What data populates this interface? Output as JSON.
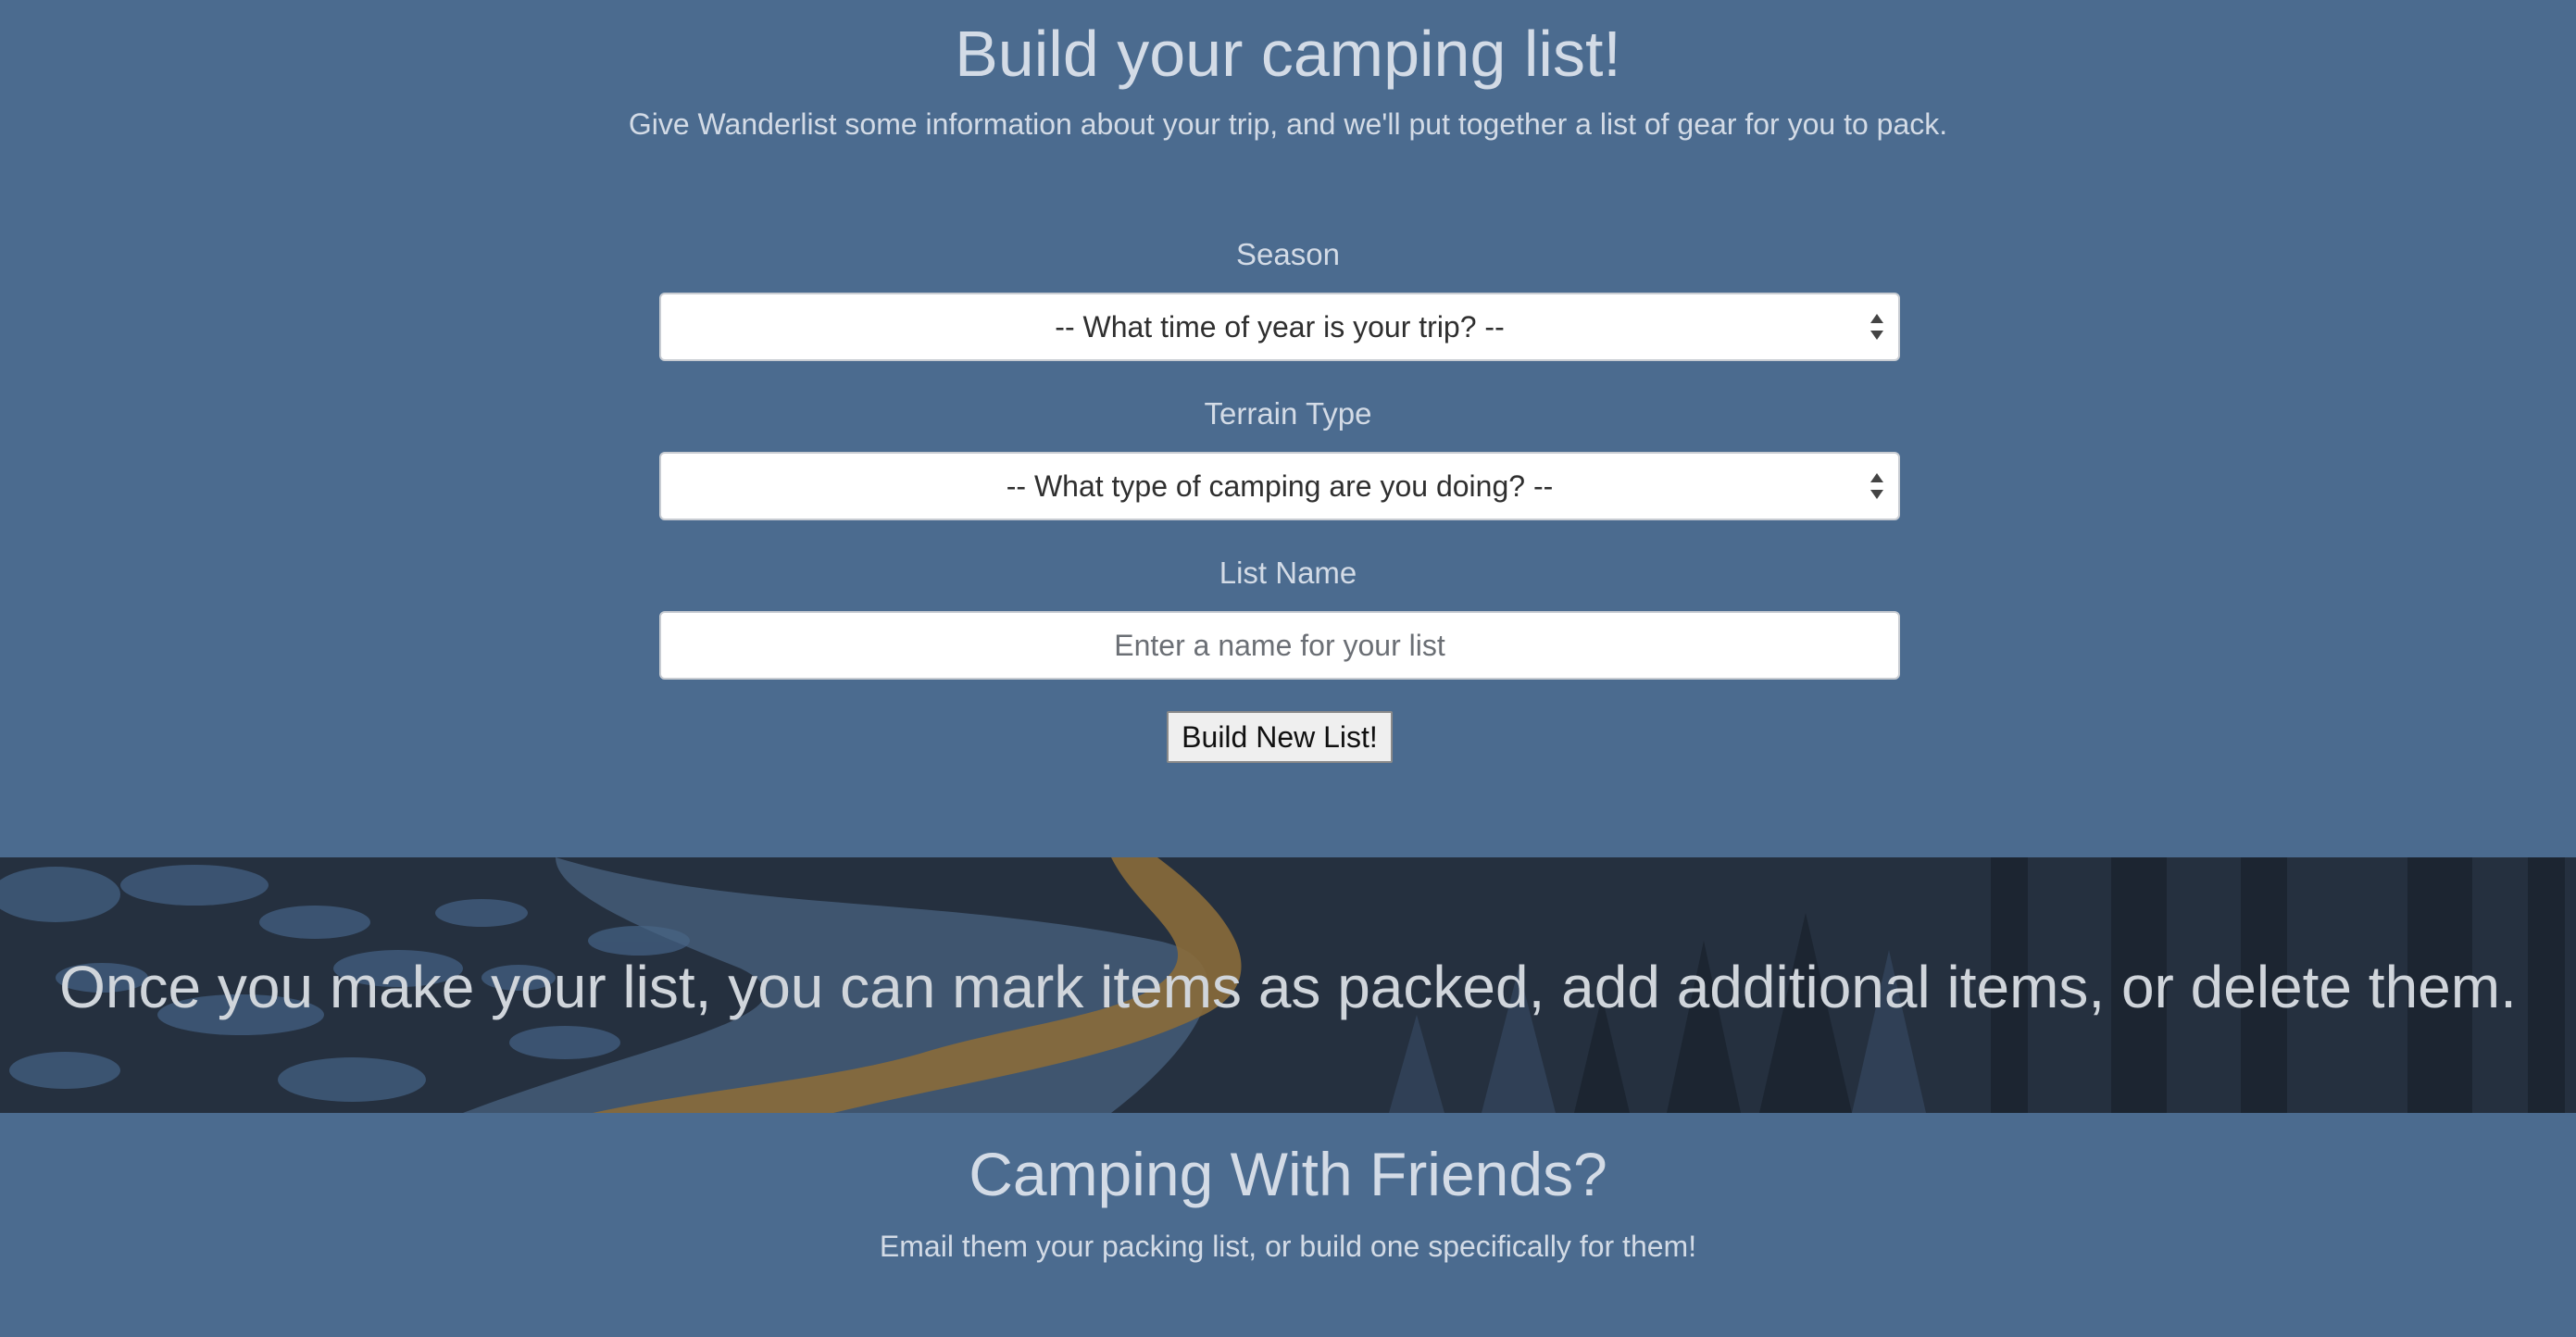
{
  "build": {
    "title": "Build your camping list!",
    "subtitle": "Give Wanderlist some information about your trip, and we'll put together a list of gear for you to pack.",
    "season_label": "Season",
    "season_value": "-- What time of year is your trip? --",
    "terrain_label": "Terrain Type",
    "terrain_value": "-- What type of camping are you doing? --",
    "list_name_label": "List Name",
    "list_name_placeholder": "Enter a name for your list",
    "button_label": "Build New List!"
  },
  "banner": {
    "text": "Once you make your list, you can mark items as packed, add additional items, or delete them."
  },
  "friends": {
    "title": "Camping With Friends?",
    "subtitle": "Email them your packing list, or build one specifically for them!"
  },
  "colors": {
    "background": "#4b6b8f",
    "banner_background": "#25303f",
    "banner_accent": "#8a6b3a",
    "text": "#d3dbe6"
  }
}
